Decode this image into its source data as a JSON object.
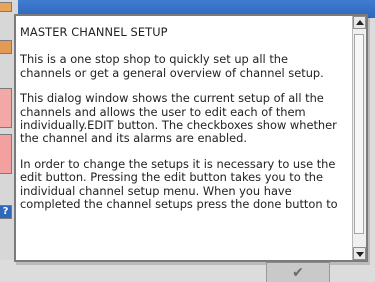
{
  "dialog": {
    "title": "MASTER CHANNEL SETUP",
    "paragraphs": [
      "This is a one stop shop to quickly set up all the channels or get a general overview of channel setup.",
      "This dialog window shows the current setup of all the channels and allows the user to edit each of them individually.EDIT button. The checkboxes show whether the channel and its alarms are enabled.",
      "In order to change the setups it is necessary to use the edit button. Pressing the edit button takes you to the individual channel setup menu. When you have completed the channel setups press the done button to"
    ]
  },
  "help_button": {
    "label": "?"
  },
  "done_button": {
    "icon": "checkmark-icon",
    "symbol": "✔"
  }
}
